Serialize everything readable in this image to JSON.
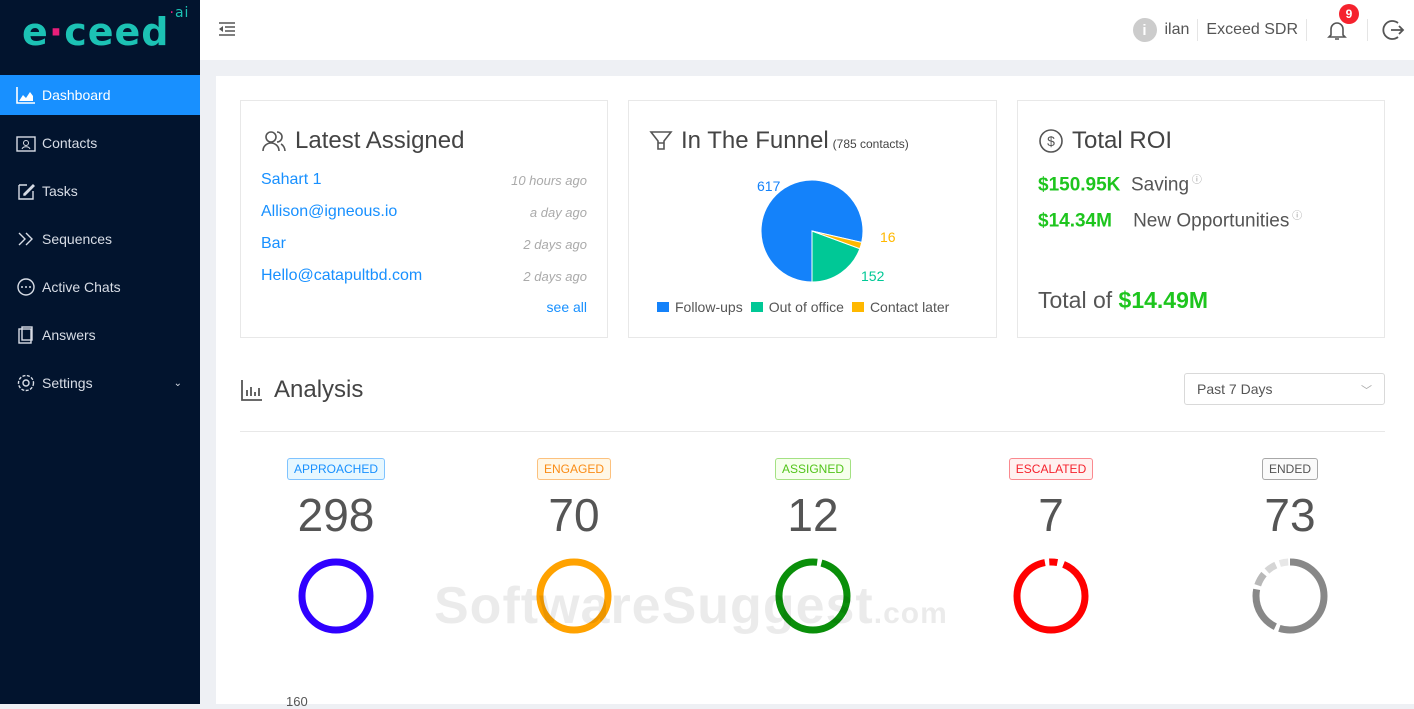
{
  "brand": {
    "name": "exceed",
    "suffix": "ai"
  },
  "sidebar": {
    "items": [
      {
        "label": "Dashboard",
        "icon": "chart-area-icon",
        "active": true
      },
      {
        "label": "Contacts",
        "icon": "contacts-icon"
      },
      {
        "label": "Tasks",
        "icon": "edit-icon"
      },
      {
        "label": "Sequences",
        "icon": "double-chevron-icon"
      },
      {
        "label": "Active Chats",
        "icon": "chat-icon"
      },
      {
        "label": "Answers",
        "icon": "clipboard-icon"
      },
      {
        "label": "Settings",
        "icon": "gear-icon",
        "has_submenu": true
      }
    ]
  },
  "header": {
    "user_initial": "i",
    "user": "ilan",
    "org": "Exceed SDR",
    "notifications": "9"
  },
  "latest": {
    "title": "Latest Assigned",
    "items": [
      {
        "name": "Sahart 1",
        "time": "10 hours ago"
      },
      {
        "name": "Allison@igneous.io",
        "time": "a day ago"
      },
      {
        "name": "Bar",
        "time": "2 days ago"
      },
      {
        "name": "Hello@catapultbd.com",
        "time": "2 days ago"
      }
    ],
    "see_all": "see all"
  },
  "funnel": {
    "title": "In The Funnel",
    "subtitle": "(785 contacts)"
  },
  "roi": {
    "title": "Total ROI",
    "saving_value": "$150.95K",
    "saving_label": "Saving",
    "opp_value": "$14.34M",
    "opp_label": "New Opportunities",
    "total_label": "Total of",
    "total_value": "$14.49M"
  },
  "analysis": {
    "title": "Analysis",
    "range": "Past 7 Days",
    "stats": [
      {
        "label": "APPROACHED",
        "value": "298",
        "color": "#2f00ff",
        "tag_color": "#1890ff",
        "tag_bg": "#e6f7ff"
      },
      {
        "label": "ENGAGED",
        "value": "70",
        "color": "#ffa200",
        "tag_color": "#fa8c16",
        "tag_bg": "#fff7e6"
      },
      {
        "label": "ASSIGNED",
        "value": "12",
        "color": "#0a8f0a",
        "tag_color": "#52c41a",
        "tag_bg": "#f6ffed"
      },
      {
        "label": "ESCALATED",
        "value": "7",
        "color": "#ff0000",
        "tag_color": "#f5222d",
        "tag_bg": "#fff1f0"
      },
      {
        "label": "ENDED",
        "value": "73",
        "color": "#888888",
        "tag_color": "#555555",
        "tag_bg": "#fafafa"
      }
    ],
    "y_tick": "160"
  },
  "watermark": {
    "text": "SoftwareSuggest",
    ".com": ".com"
  },
  "chart_data": {
    "type": "pie",
    "title": "In The Funnel",
    "categories": [
      "Follow-ups",
      "Out of office",
      "Contact later"
    ],
    "values": [
      617,
      152,
      16
    ],
    "colors": [
      "#1482fa",
      "#00c896",
      "#ffb800"
    ],
    "legend": "bottom"
  }
}
